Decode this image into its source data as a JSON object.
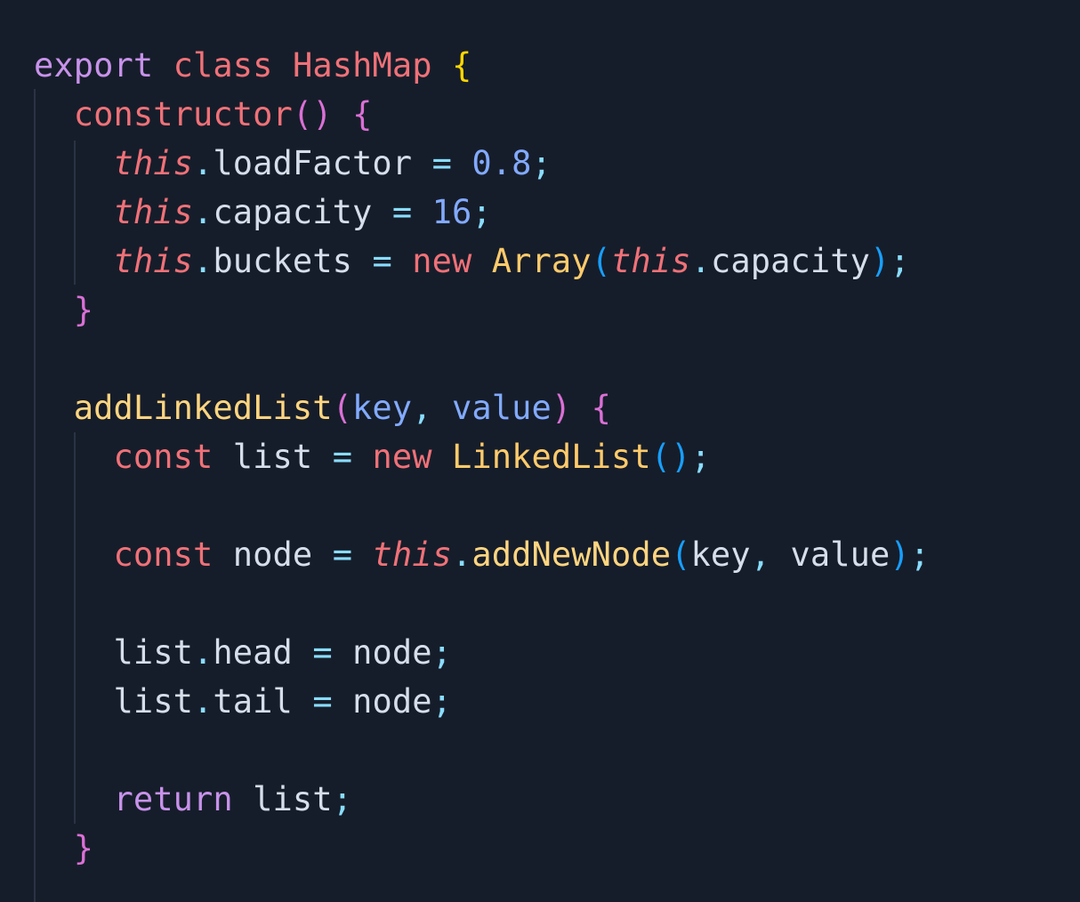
{
  "colors": {
    "background": "#161d2a",
    "indent_guide": "#2a3344",
    "keyword_purple": "#c792ea",
    "keyword_red": "#f07178",
    "class_yellow": "#ffcb6b",
    "function_yellow": "#ffd580",
    "bracket_yellow": "#ffd700",
    "bracket_pink": "#da70d6",
    "bracket_blue": "#179fff",
    "number_blue": "#82aaff",
    "param_blue": "#82aaff",
    "operator_cyan": "#89ddff",
    "punct_cyan": "#89ddff",
    "text": "#d6deeb"
  },
  "code": {
    "lines": [
      [
        {
          "t": "export",
          "c": "keyword_purple"
        },
        {
          "t": " ",
          "c": "text"
        },
        {
          "t": "class",
          "c": "keyword_red"
        },
        {
          "t": " ",
          "c": "text"
        },
        {
          "t": "HashMap",
          "c": "keyword_red"
        },
        {
          "t": " ",
          "c": "text"
        },
        {
          "t": "{",
          "c": "bracket_yellow"
        }
      ],
      [
        {
          "t": "  ",
          "c": "text"
        },
        {
          "t": "constructor",
          "c": "keyword_red"
        },
        {
          "t": "()",
          "c": "bracket_pink"
        },
        {
          "t": " ",
          "c": "text"
        },
        {
          "t": "{",
          "c": "bracket_pink"
        }
      ],
      [
        {
          "t": "    ",
          "c": "text"
        },
        {
          "t": "this",
          "c": "keyword_red",
          "i": true
        },
        {
          "t": ".",
          "c": "punct_cyan"
        },
        {
          "t": "loadFactor",
          "c": "text"
        },
        {
          "t": " ",
          "c": "text"
        },
        {
          "t": "=",
          "c": "operator_cyan"
        },
        {
          "t": " ",
          "c": "text"
        },
        {
          "t": "0.8",
          "c": "number_blue"
        },
        {
          "t": ";",
          "c": "punct_cyan"
        }
      ],
      [
        {
          "t": "    ",
          "c": "text"
        },
        {
          "t": "this",
          "c": "keyword_red",
          "i": true
        },
        {
          "t": ".",
          "c": "punct_cyan"
        },
        {
          "t": "capacity",
          "c": "text"
        },
        {
          "t": " ",
          "c": "text"
        },
        {
          "t": "=",
          "c": "operator_cyan"
        },
        {
          "t": " ",
          "c": "text"
        },
        {
          "t": "16",
          "c": "number_blue"
        },
        {
          "t": ";",
          "c": "punct_cyan"
        }
      ],
      [
        {
          "t": "    ",
          "c": "text"
        },
        {
          "t": "this",
          "c": "keyword_red",
          "i": true
        },
        {
          "t": ".",
          "c": "punct_cyan"
        },
        {
          "t": "buckets",
          "c": "text"
        },
        {
          "t": " ",
          "c": "text"
        },
        {
          "t": "=",
          "c": "operator_cyan"
        },
        {
          "t": " ",
          "c": "text"
        },
        {
          "t": "new",
          "c": "keyword_red"
        },
        {
          "t": " ",
          "c": "text"
        },
        {
          "t": "Array",
          "c": "class_yellow"
        },
        {
          "t": "(",
          "c": "bracket_blue"
        },
        {
          "t": "this",
          "c": "keyword_red",
          "i": true
        },
        {
          "t": ".",
          "c": "punct_cyan"
        },
        {
          "t": "capacity",
          "c": "text"
        },
        {
          "t": ")",
          "c": "bracket_blue"
        },
        {
          "t": ";",
          "c": "punct_cyan"
        }
      ],
      [
        {
          "t": "  ",
          "c": "text"
        },
        {
          "t": "}",
          "c": "bracket_pink"
        }
      ],
      [],
      [
        {
          "t": "  ",
          "c": "text"
        },
        {
          "t": "addLinkedList",
          "c": "function_yellow"
        },
        {
          "t": "(",
          "c": "bracket_pink"
        },
        {
          "t": "key",
          "c": "param_blue"
        },
        {
          "t": ",",
          "c": "punct_cyan"
        },
        {
          "t": " ",
          "c": "text"
        },
        {
          "t": "value",
          "c": "param_blue"
        },
        {
          "t": ")",
          "c": "bracket_pink"
        },
        {
          "t": " ",
          "c": "text"
        },
        {
          "t": "{",
          "c": "bracket_pink"
        }
      ],
      [
        {
          "t": "    ",
          "c": "text"
        },
        {
          "t": "const",
          "c": "keyword_red"
        },
        {
          "t": " ",
          "c": "text"
        },
        {
          "t": "list",
          "c": "text"
        },
        {
          "t": " ",
          "c": "text"
        },
        {
          "t": "=",
          "c": "operator_cyan"
        },
        {
          "t": " ",
          "c": "text"
        },
        {
          "t": "new",
          "c": "keyword_red"
        },
        {
          "t": " ",
          "c": "text"
        },
        {
          "t": "LinkedList",
          "c": "class_yellow"
        },
        {
          "t": "()",
          "c": "bracket_blue"
        },
        {
          "t": ";",
          "c": "punct_cyan"
        }
      ],
      [],
      [
        {
          "t": "    ",
          "c": "text"
        },
        {
          "t": "const",
          "c": "keyword_red"
        },
        {
          "t": " ",
          "c": "text"
        },
        {
          "t": "node",
          "c": "text"
        },
        {
          "t": " ",
          "c": "text"
        },
        {
          "t": "=",
          "c": "operator_cyan"
        },
        {
          "t": " ",
          "c": "text"
        },
        {
          "t": "this",
          "c": "keyword_red",
          "i": true
        },
        {
          "t": ".",
          "c": "punct_cyan"
        },
        {
          "t": "addNewNode",
          "c": "function_yellow"
        },
        {
          "t": "(",
          "c": "bracket_blue"
        },
        {
          "t": "key",
          "c": "text"
        },
        {
          "t": ",",
          "c": "punct_cyan"
        },
        {
          "t": " ",
          "c": "text"
        },
        {
          "t": "value",
          "c": "text"
        },
        {
          "t": ")",
          "c": "bracket_blue"
        },
        {
          "t": ";",
          "c": "punct_cyan"
        }
      ],
      [],
      [
        {
          "t": "    ",
          "c": "text"
        },
        {
          "t": "list",
          "c": "text"
        },
        {
          "t": ".",
          "c": "punct_cyan"
        },
        {
          "t": "head",
          "c": "text"
        },
        {
          "t": " ",
          "c": "text"
        },
        {
          "t": "=",
          "c": "operator_cyan"
        },
        {
          "t": " ",
          "c": "text"
        },
        {
          "t": "node",
          "c": "text"
        },
        {
          "t": ";",
          "c": "punct_cyan"
        }
      ],
      [
        {
          "t": "    ",
          "c": "text"
        },
        {
          "t": "list",
          "c": "text"
        },
        {
          "t": ".",
          "c": "punct_cyan"
        },
        {
          "t": "tail",
          "c": "text"
        },
        {
          "t": " ",
          "c": "text"
        },
        {
          "t": "=",
          "c": "operator_cyan"
        },
        {
          "t": " ",
          "c": "text"
        },
        {
          "t": "node",
          "c": "text"
        },
        {
          "t": ";",
          "c": "punct_cyan"
        }
      ],
      [],
      [
        {
          "t": "    ",
          "c": "text"
        },
        {
          "t": "return",
          "c": "keyword_purple"
        },
        {
          "t": " ",
          "c": "text"
        },
        {
          "t": "list",
          "c": "text"
        },
        {
          "t": ";",
          "c": "punct_cyan"
        }
      ],
      [
        {
          "t": "  ",
          "c": "text"
        },
        {
          "t": "}",
          "c": "bracket_pink"
        }
      ]
    ]
  }
}
